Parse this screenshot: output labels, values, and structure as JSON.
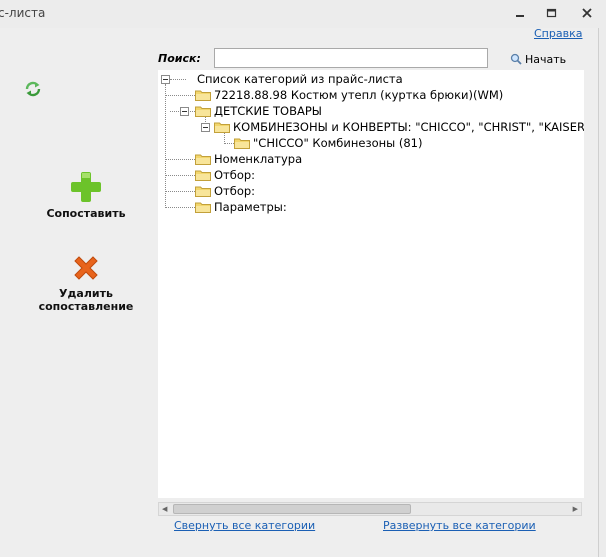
{
  "window": {
    "title": "с-листа",
    "help_link": "Справка"
  },
  "left_panel": {
    "map_button_label": "Сопоставить",
    "delete_button_label_line1": "Удалить",
    "delete_button_label_line2": "сопоставление"
  },
  "search": {
    "label": "Поиск:",
    "value": "",
    "start_label": "Начать"
  },
  "tree": {
    "root": "Список категорий из прайс-листа",
    "items": [
      "72218.88.98 Костюм утепл (куртка брюки)(WM)",
      "ДЕТСКИЕ ТОВАРЫ",
      "КОМБИНЕЗОНЫ и КОНВЕРТЫ:  \"CHICCO\", \"CHRIST\", \"KAISER\"",
      "\"CHICCO\" Комбинезоны (81)",
      "Номенклатура",
      "Отбор:",
      "Отбор:",
      "Параметры:"
    ]
  },
  "footer": {
    "collapse_all": "Свернуть все категории",
    "expand_all": "Развернуть все категории"
  },
  "colors": {
    "link": "#1a5fb4",
    "add_icon": "#6cc32a",
    "delete_icon": "#e8641c",
    "folder": "#f2d66c"
  },
  "icons": [
    "refresh-icon",
    "plus-icon",
    "delete-x-icon",
    "search-icon",
    "folder-icon",
    "minimize-icon",
    "maximize-icon",
    "close-icon"
  ]
}
